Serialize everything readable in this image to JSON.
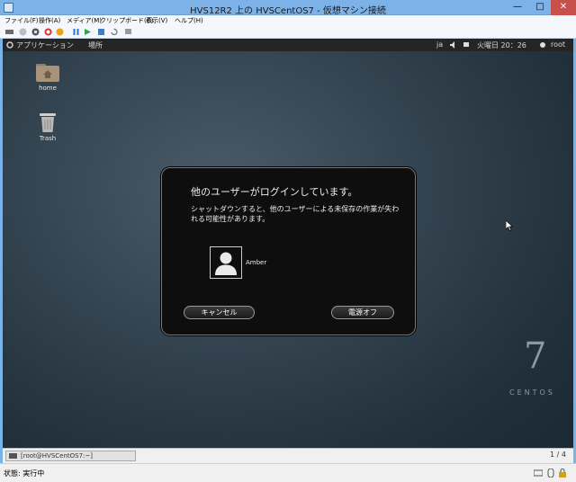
{
  "window": {
    "title": "HVS12R2 上の HVSCentOS7 - 仮想マシン接続",
    "min": "—",
    "max": "□",
    "close": "✕"
  },
  "menubar": [
    "ファイル(F)",
    "操作(A)",
    "メディア(M)",
    "クリップボード(C)",
    "表示(V)",
    "ヘルプ(H)"
  ],
  "toolbar": [
    "ctrl-alt-del-icon",
    "start-icon",
    "turn-off-icon",
    "shutdown-icon",
    "save-icon",
    "pause-icon",
    "resume-icon",
    "checkpoint-icon",
    "revert-icon",
    "enhanced-session-icon"
  ],
  "gnome": {
    "applications": "アプリケーション",
    "places": "場所",
    "lang": "ja",
    "clock": "火曜日 20：26",
    "user": "root"
  },
  "desktop": {
    "home": "home",
    "trash": "Trash"
  },
  "branding": {
    "seven": "7",
    "word": "CENTOS"
  },
  "dialog": {
    "heading": "他のユーザーがログインしています。",
    "message": "シャットダウンすると、他のユーザーによる未保存の作業が失われる可能性があります。",
    "user": "Amber",
    "cancel": "キャンセル",
    "power_off": "電源オフ"
  },
  "taskbar": {
    "task": "[root@HVSCentOS7:~]",
    "workspace": "1 / 4"
  },
  "status": {
    "text": "状態: 実行中"
  }
}
